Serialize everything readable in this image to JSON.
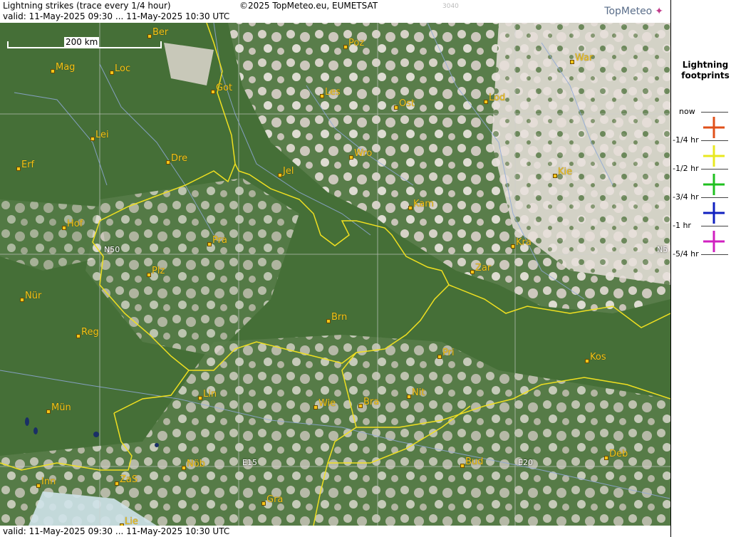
{
  "header": {
    "title": "Lightning strikes (trace every 1/4 hour)",
    "copyright": "©2025 TopMeteo.eu, EUMETSAT",
    "code": "3040",
    "valid": "valid:  11-May-2025 09:30 ... 11-May-2025 10:30 UTC",
    "logo": "TopMeteo"
  },
  "footer": {
    "valid": "valid:  11-May-2025 09:30 ... 11-May-2025 10:30 UTC"
  },
  "scale": {
    "label": "200 km"
  },
  "cities": [
    "Ber",
    "Poz",
    "War",
    "Mag",
    "Loc",
    "Got",
    "Les",
    "Lod",
    "Ost",
    "Lei",
    "Wro",
    "Dre",
    "Erf",
    "Jel",
    "Kie",
    "Kam",
    "Hof",
    "Pra",
    "Kra",
    "Plz",
    "Zar",
    "Nür",
    "Brn",
    "Reg",
    "Pri",
    "Kos",
    "Lin",
    "Nit",
    "Wie",
    "Bra",
    "Mün",
    "Deb",
    "Bud",
    "Nöb",
    "ZaS",
    "Inn",
    "Gra",
    "Lie"
  ],
  "coords": [
    "N50",
    "N5",
    "E15",
    "E20"
  ],
  "legend": {
    "title_line1": "Lightning",
    "title_line2": "footprints",
    "items": [
      {
        "label": "now",
        "color": ""
      },
      {
        "label": "-1/4 hr",
        "color": "#e0501a"
      },
      {
        "label": "-1/2 hr",
        "color": "#e8e820"
      },
      {
        "label": "-3/4 hr",
        "color": "#20c020"
      },
      {
        "label": "-1 hr",
        "color": "#1020c0"
      },
      {
        "label": "-5/4 hr",
        "color": "#d020c0"
      }
    ]
  },
  "colors": {
    "city": "#f4c518",
    "border": "#f0e020",
    "rivers": "#8fa8d8",
    "grid": "#cfcfcf"
  }
}
